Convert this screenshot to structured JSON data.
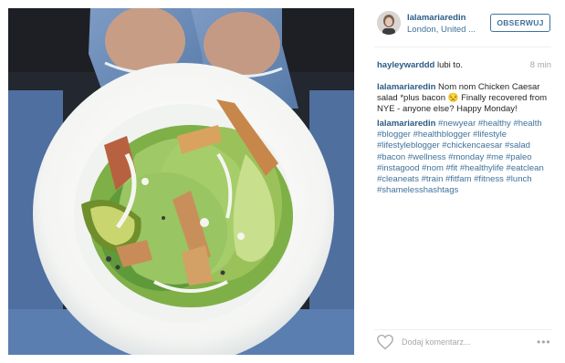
{
  "post": {
    "author": "lalamariaredin",
    "location": "London, United ...",
    "follow_label": "OBSERWUJ"
  },
  "likes": {
    "liker": "hayleywarddd",
    "text": " lubi to.",
    "time": "8 min"
  },
  "caption": {
    "user": "lalamariaredin",
    "text": " Nom nom Chicken Caesar salad *plus bacon 😒 Finally recovered from NYE - anyone else? Happy Monday!"
  },
  "hashtags": {
    "user": "lalamariaredin",
    "text": " #newyear #healthy #health #blogger #healthblogger #lifestyle #lifestyleblogger #chickencaesar #salad #bacon #wellness #monday #me #paleo #instagood #nom #fit #healthylife #eatclean #cleaneats #train #fitfam #fitness #lunch #shamelesshashtags"
  },
  "footer": {
    "comment_placeholder": "Dodaj komentarz...",
    "more_label": "•••"
  }
}
